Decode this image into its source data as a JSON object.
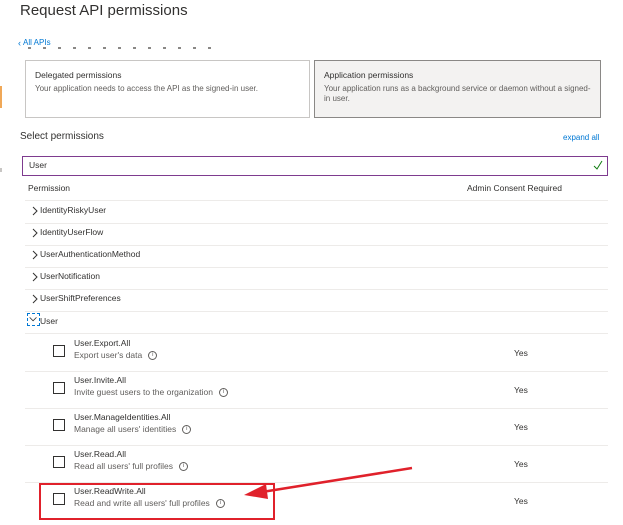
{
  "header": {
    "title": "Request API permissions"
  },
  "back_link": {
    "label": "All APIs"
  },
  "permission_types": [
    {
      "title": "Delegated permissions",
      "description": "Your application needs to access the API as the signed-in user."
    },
    {
      "title": "Application permissions",
      "description": "Your application runs as a background service or daemon without a signed-in user."
    }
  ],
  "select": {
    "label": "Select permissions",
    "expand_all": "expand all"
  },
  "search": {
    "value": "User"
  },
  "table": {
    "headers": {
      "permission": "Permission",
      "admin_consent": "Admin Consent Required"
    },
    "collapsed_groups": [
      "IdentityRiskyUser",
      "IdentityUserFlow",
      "UserAuthenticationMethod",
      "UserNotification",
      "UserShiftPreferences"
    ],
    "expanded_group": "User",
    "permissions": [
      {
        "name": "User.Export.All",
        "description": "Export user's data",
        "admin_consent": "Yes"
      },
      {
        "name": "User.Invite.All",
        "description": "Invite guest users to the organization",
        "admin_consent": "Yes"
      },
      {
        "name": "User.ManageIdentities.All",
        "description": "Manage all users' identities",
        "admin_consent": "Yes"
      },
      {
        "name": "User.Read.All",
        "description": "Read all users' full profiles",
        "admin_consent": "Yes"
      },
      {
        "name": "User.ReadWrite.All",
        "description": "Read and write all users' full profiles",
        "admin_consent": "Yes"
      }
    ]
  },
  "annotation": {
    "color": "#e0212b"
  },
  "colors": {
    "accent": "#0078d4",
    "focus_border": "#7e3b8f",
    "check": "#107c10"
  }
}
